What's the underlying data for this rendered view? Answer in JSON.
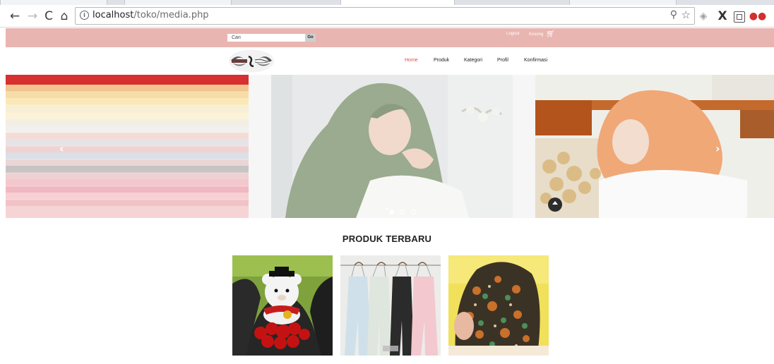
{
  "browser": {
    "url_host": "localhost",
    "url_path": "/toko/media.php",
    "icons": {
      "back": "back-arrow-icon",
      "forward": "forward-arrow-icon",
      "reload": "reload-icon",
      "home": "home-icon",
      "info": "info-icon",
      "zoom": "zoom-icon",
      "bookmark": "star-icon"
    }
  },
  "header": {
    "search_placeholder": "Cari",
    "search_button": "Go",
    "logout_label": "Logout",
    "cart_label": "Kosong",
    "bar_color": "#e9b5b1"
  },
  "nav": {
    "items": [
      {
        "label": "Home",
        "active": true
      },
      {
        "label": "Produk",
        "active": false
      },
      {
        "label": "Kategori",
        "active": false
      },
      {
        "label": "Profil",
        "active": false
      },
      {
        "label": "Konfirmasi",
        "active": false
      }
    ],
    "active_color": "#d9534f"
  },
  "carousel": {
    "prev_icon": "chevron-left-icon",
    "next_icon": "chevron-right-icon",
    "indicator_count": 3,
    "active_indicator": 0
  },
  "products": {
    "title": "PRODUK TERBARU"
  }
}
